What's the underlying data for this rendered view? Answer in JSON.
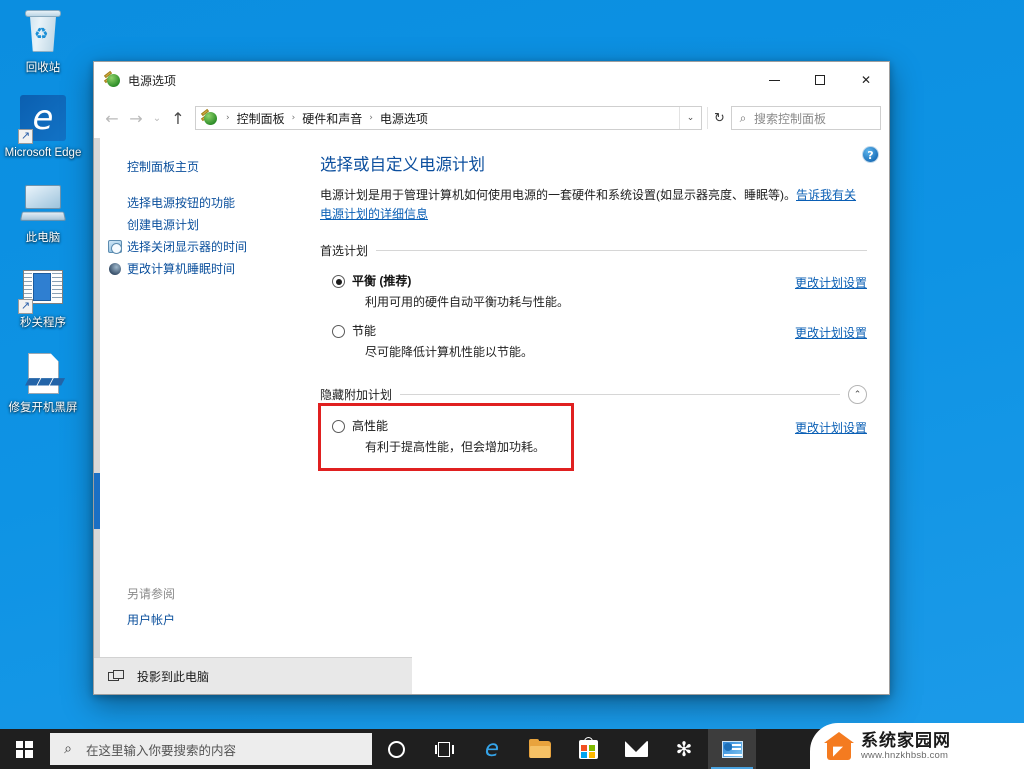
{
  "desktop": {
    "icons": [
      {
        "label": "回收站",
        "icon": "recycle-bin-icon"
      },
      {
        "label": "Microsoft Edge",
        "icon": "edge-icon"
      },
      {
        "label": "此电脑",
        "icon": "this-pc-icon"
      },
      {
        "label": "秒关程序",
        "icon": "app-shortcut-icon"
      },
      {
        "label": "修复开机黑屏",
        "icon": "document-shortcut-icon"
      }
    ],
    "background_color": "#0d93e3"
  },
  "window": {
    "title": "电源选项",
    "controls": {
      "minimize": "—",
      "maximize": "□",
      "close": "✕"
    },
    "nav": {
      "back": "←",
      "forward": "→",
      "recent": "⌄",
      "up": "↑",
      "breadcrumb": [
        "控制面板",
        "硬件和声音",
        "电源选项"
      ],
      "separator": "›",
      "dropdown": "⌄",
      "refresh": "↻"
    },
    "search": {
      "placeholder": "搜索控制面板",
      "icon": "search-icon"
    },
    "help_button": "?"
  },
  "sidebar": {
    "home_link": "控制面板主页",
    "items": [
      {
        "label": "选择电源按钮的功能",
        "icon": null
      },
      {
        "label": "创建电源计划",
        "icon": null
      },
      {
        "label": "选择关闭显示器的时间",
        "icon": "clock-icon"
      },
      {
        "label": "更改计算机睡眠时间",
        "icon": "moon-icon"
      }
    ],
    "see_also_title": "另请参阅",
    "see_also_items": [
      "用户帐户"
    ]
  },
  "content": {
    "title": "选择或自定义电源计划",
    "description_text": "电源计划是用于管理计算机如何使用电源的一套硬件和系统设置(如显示器亮度、睡眠等)。",
    "description_link": "告诉我有关电源计划的详细信息",
    "groups": [
      {
        "title": "首选计划",
        "collapsible": false,
        "plans": [
          {
            "name": "平衡 (推荐)",
            "description": "利用可用的硬件自动平衡功耗与性能。",
            "selected": true,
            "change_link": "更改计划设置",
            "highlighted": false
          },
          {
            "name": "节能",
            "description": "尽可能降低计算机性能以节能。",
            "selected": false,
            "change_link": "更改计划设置",
            "highlighted": false
          }
        ]
      },
      {
        "title": "隐藏附加计划",
        "collapsible": true,
        "collapse_icon": "chevron-up-icon",
        "plans": [
          {
            "name": "高性能",
            "description": "有利于提高性能，但会增加功耗。",
            "selected": false,
            "change_link": "更改计划设置",
            "highlighted": true
          }
        ]
      }
    ],
    "highlight_color": "#e02020"
  },
  "statusbar": {
    "text": "投影到此电脑",
    "icon": "project-screen-icon"
  },
  "taskbar": {
    "start_label": "开始",
    "search_placeholder": "在这里输入你要搜索的内容",
    "items": [
      {
        "name": "cortana",
        "icon": "circle-icon"
      },
      {
        "name": "task-view",
        "icon": "task-view-icon"
      },
      {
        "name": "edge",
        "icon": "edge-icon"
      },
      {
        "name": "file-explorer",
        "icon": "folder-icon"
      },
      {
        "name": "microsoft-store",
        "icon": "store-icon"
      },
      {
        "name": "mail",
        "icon": "mail-icon"
      },
      {
        "name": "settings",
        "icon": "gear-icon"
      },
      {
        "name": "power-options",
        "icon": "power-options-icon",
        "active": true
      }
    ]
  },
  "watermark": {
    "name": "系统家园网",
    "url": "www.hnzkhbsb.com",
    "accent": "#f47b20"
  }
}
